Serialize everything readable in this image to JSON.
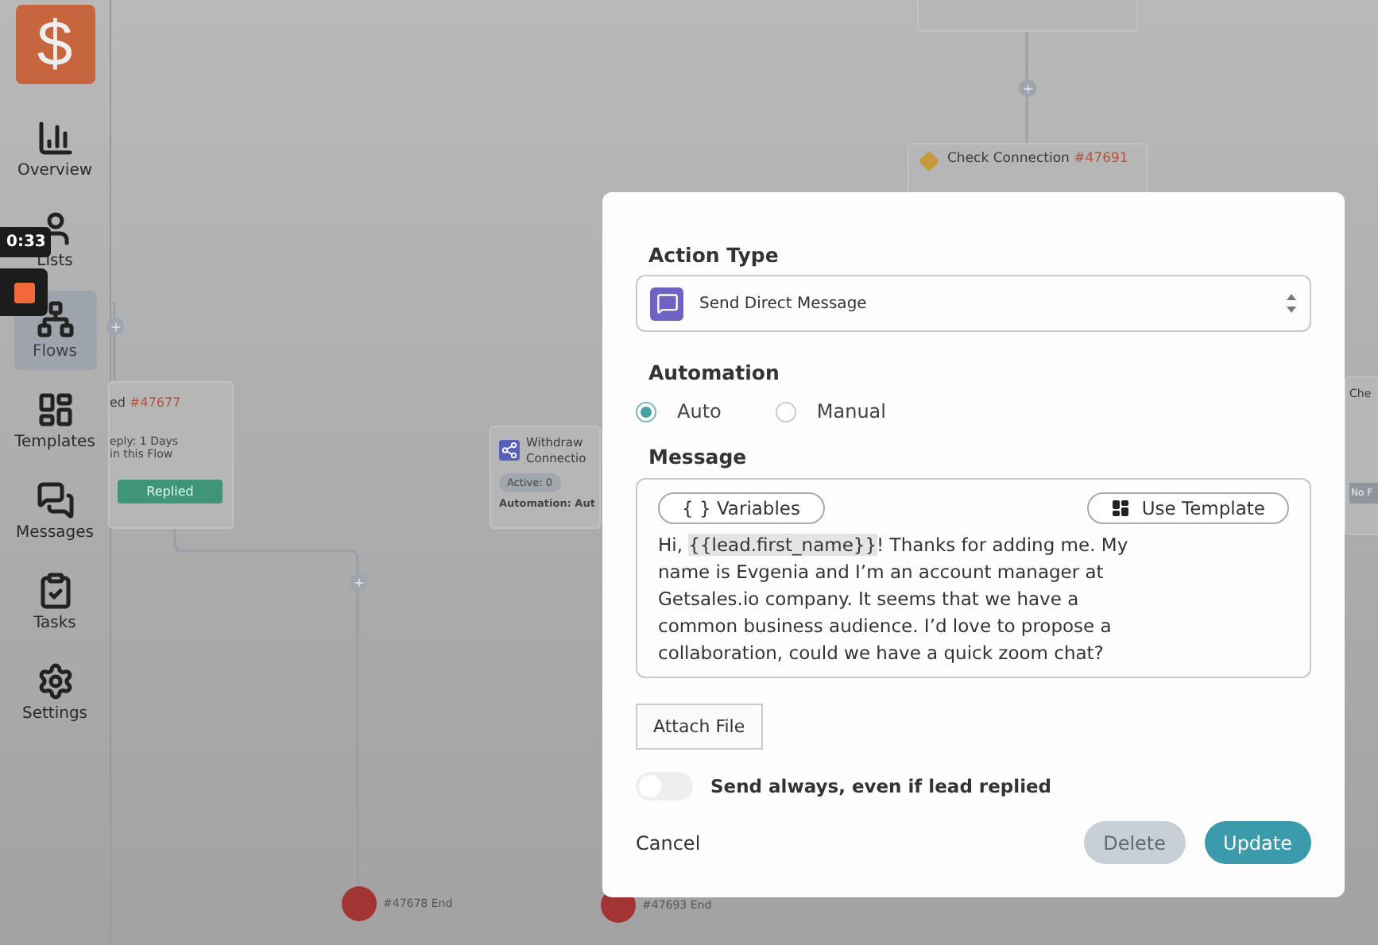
{
  "sidebar": {
    "logo": "$",
    "items": [
      {
        "label": "Overview",
        "selected": false
      },
      {
        "label": "Lists",
        "selected": false
      },
      {
        "label": "Flows",
        "selected": true
      },
      {
        "label": "Templates",
        "selected": false
      },
      {
        "label": "Messages",
        "selected": false
      },
      {
        "label": "Tasks",
        "selected": false
      },
      {
        "label": "Settings",
        "selected": false
      }
    ]
  },
  "recorder": {
    "time": "0:33"
  },
  "canvas": {
    "nodes": [
      {
        "kind": "message_top"
      },
      {
        "kind": "condition",
        "title": "Check Connection",
        "id": "#47691"
      },
      {
        "kind": "wait",
        "title": "ed",
        "id": "#47677",
        "lines": [
          "eply: 1 Days",
          "in this Flow"
        ],
        "button": "Replied"
      },
      {
        "kind": "action",
        "title": [
          "Withdraw",
          "Connectio"
        ],
        "badge": "Active: 0",
        "footer": "Automation: Aut"
      },
      {
        "kind": "side",
        "title": "Che",
        "button": "No F"
      },
      {
        "kind": "end",
        "label": "#47678 End"
      },
      {
        "kind": "end",
        "label": "#47693 End"
      }
    ]
  },
  "modal": {
    "action_type_label": "Action Type",
    "action_type": "Send Direct Message",
    "automation_label": "Automation",
    "automation_options": [
      {
        "label": "Auto",
        "selected": true
      },
      {
        "label": "Manual",
        "selected": false
      }
    ],
    "message_label": "Message",
    "variables_button": "{ } Variables",
    "template_button": "Use Template",
    "message": {
      "before": "Hi, ",
      "variable": "{{lead.first_name}}",
      "after": "! Thanks for adding me. My name is Evgenia and I’m an account manager at Getsales.io company. It seems that we have a common business audience. I’d love to propose a collaboration, could we have a quick zoom chat?"
    },
    "attach_button": "Attach File",
    "send_always": {
      "label": "Send always, even if lead replied",
      "on": false
    },
    "cancel": "Cancel",
    "delete": {
      "label": "Delete",
      "disabled": true
    },
    "update": "Update"
  }
}
